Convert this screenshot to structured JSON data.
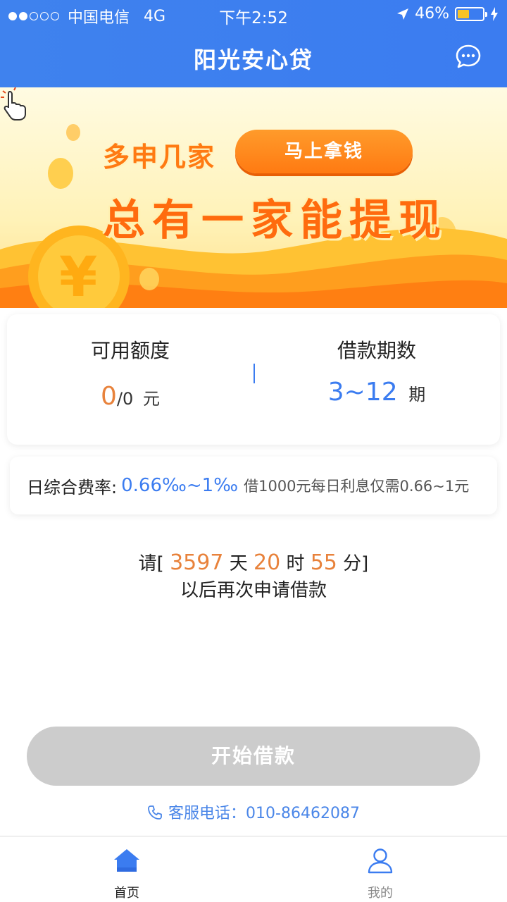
{
  "status_bar": {
    "carrier": "中国电信",
    "network": "4G",
    "time": "下午2:52",
    "battery": "46%",
    "battery_level": 0.46
  },
  "nav": {
    "title": "阳光安心贷",
    "chat_icon": "chat-bubble-icon"
  },
  "banner": {
    "line1": "多申几家",
    "cta": "马上拿钱",
    "line2": "总有一家能提现",
    "colors": {
      "orange": "#ff7a12",
      "gold": "#ffc12e"
    }
  },
  "quota": {
    "available_label": "可用额度",
    "available_value": "0",
    "available_total": "/0",
    "available_unit": "元",
    "term_label": "借款期数",
    "term_value": "3~12",
    "term_unit": "期"
  },
  "rate": {
    "label": "日综合费率:",
    "value": "0.66‰~1‰",
    "desc": "借1000元每日利息仅需0.66~1元"
  },
  "countdown": {
    "prefix": "请[",
    "days": "3597",
    "days_unit": "天",
    "hours": "20",
    "hours_unit": "时",
    "minutes": "55",
    "minutes_unit": "分]",
    "line2": "以后再次申请借款"
  },
  "action": {
    "button_label": "开始借款",
    "service_label": "客服电话：010-86462087"
  },
  "tabbar": {
    "home": "首页",
    "mine": "我的"
  },
  "colors": {
    "primary": "#3b7cf0",
    "accent": "#e8823b",
    "disabled": "#cccccc"
  }
}
